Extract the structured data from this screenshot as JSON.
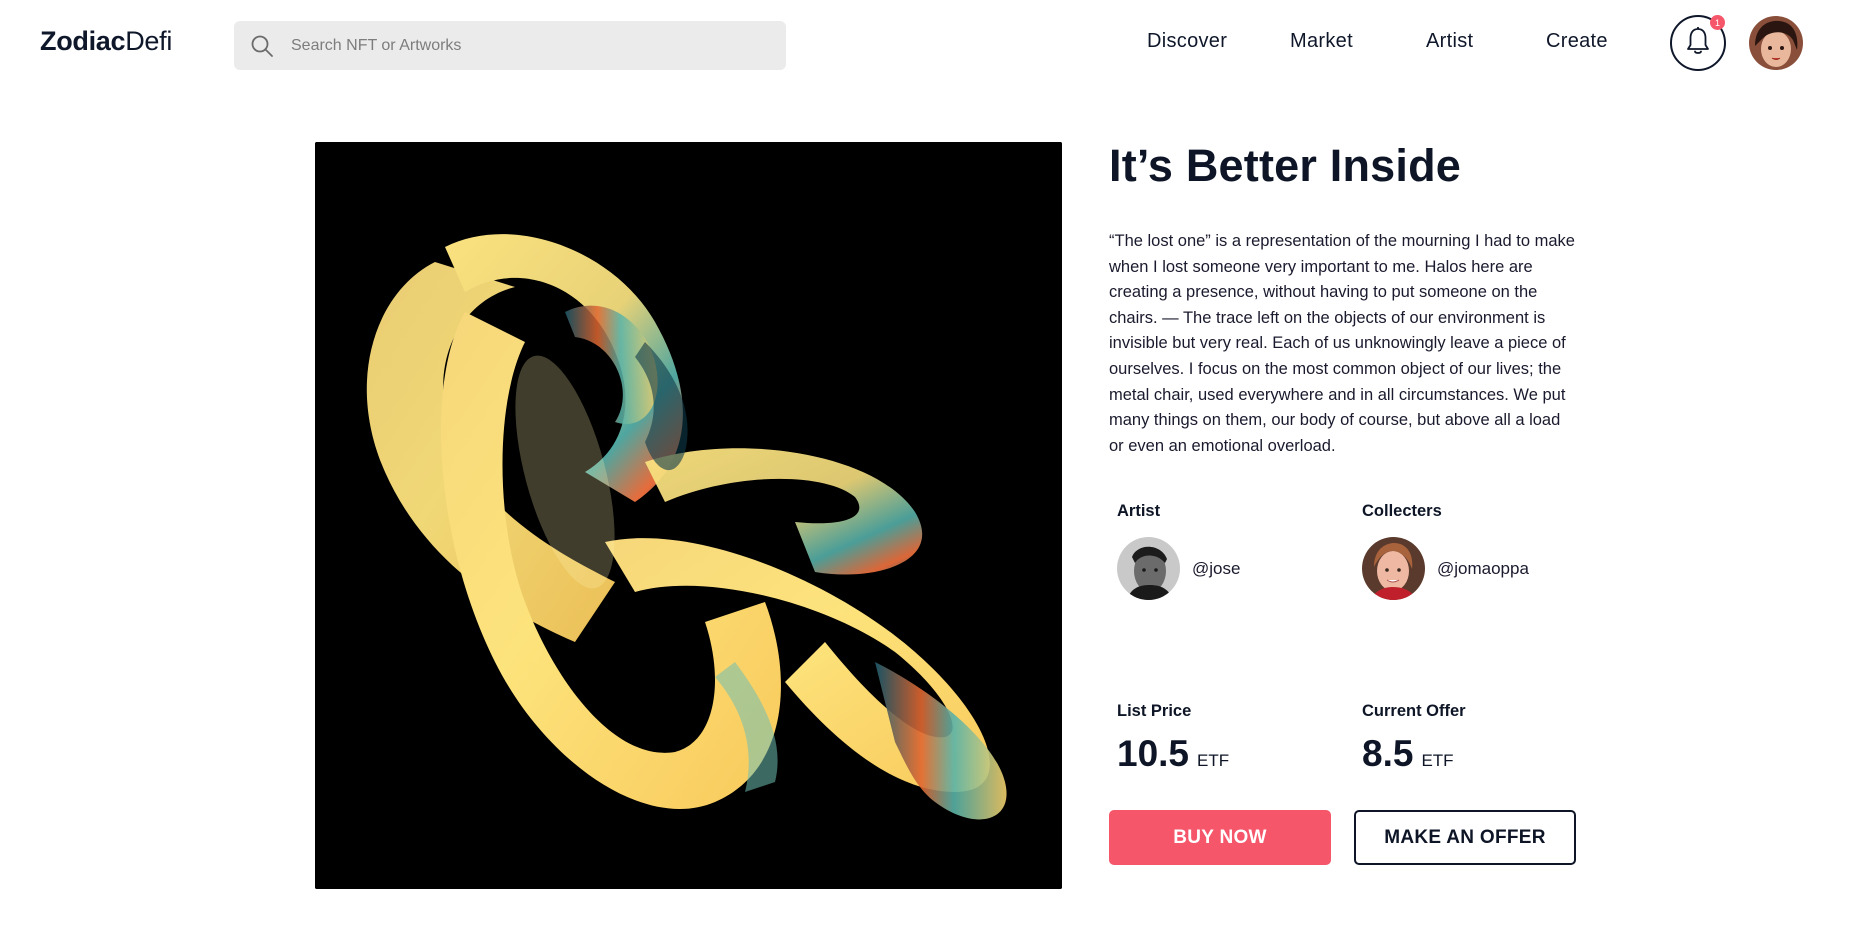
{
  "header": {
    "logo_bold": "Zodiac",
    "logo_light": "Defi",
    "search_placeholder": "Search NFT or Artworks",
    "nav": [
      "Discover",
      "Market",
      "Artist",
      "Create"
    ],
    "notification_count": "1"
  },
  "item": {
    "title": "It’s Better Inside",
    "description": "“The lost one” is a representation of the mourning I had to make when I lost someone very important to me. Halos here are creating a presence, without having to put someone on the chairs. — The trace left on the objects of our environment is invisible but very real. Each of us unknowingly leave a piece of ourselves. I focus on the most common object of our lives; the metal chair, used everywhere and in all circumstances. We put many things on them, our body of course, but above all a load or even an emotional overload.",
    "artist_label": "Artist",
    "artist_handle": "@jose",
    "collectors_label": "Collecters",
    "collector_handle": "@jomaoppa",
    "list_price_label": "List Price",
    "list_price": "10.5",
    "list_price_unit": "ETF",
    "current_offer_label": "Current Offer",
    "current_offer": "8.5",
    "current_offer_unit": "ETF",
    "buy_label": "BUY NOW",
    "offer_label": "MAKE AN OFFER"
  },
  "colors": {
    "accent": "#f5566a",
    "text": "#0d1526",
    "search_bg": "#ebebeb",
    "artwork_bg": "#000000"
  }
}
